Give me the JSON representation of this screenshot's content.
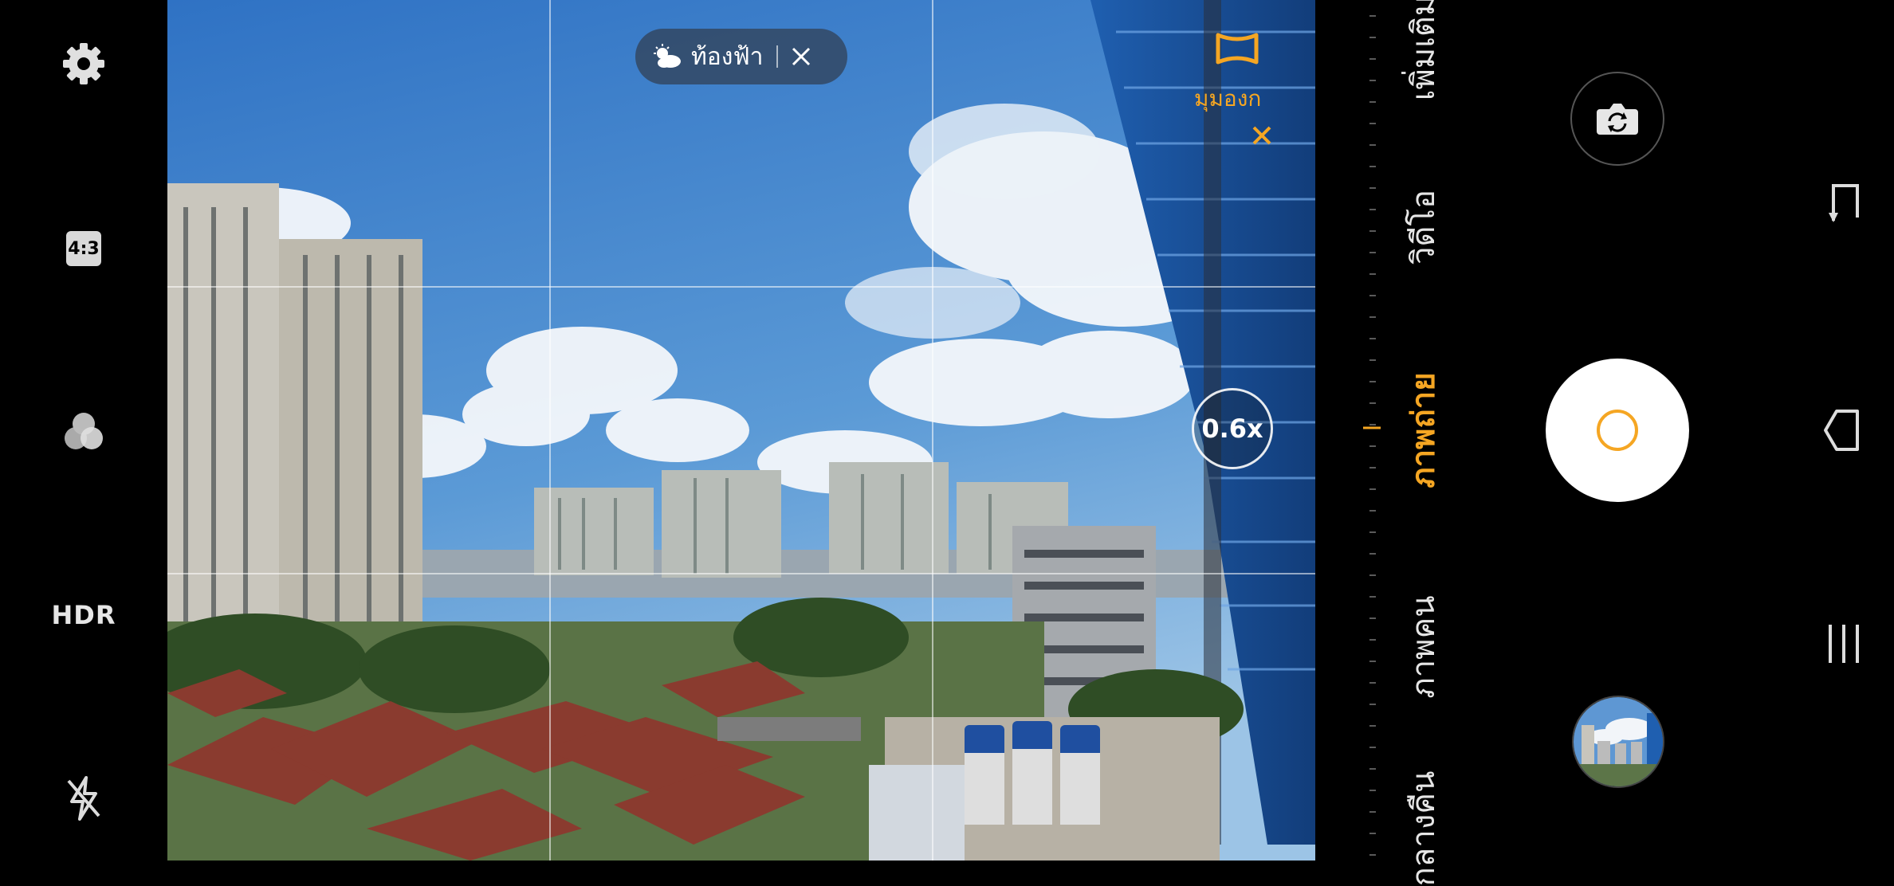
{
  "left_bar": {
    "settings_icon": "gear-icon",
    "aspect_ratio": "4:3",
    "filters_icon": "filters-icon",
    "hdr": "HDR",
    "flash_icon": "flash-off-icon"
  },
  "viewfinder": {
    "scene_optimizer": {
      "icon": "cloud-sun-icon",
      "label": "ท้องฟ้า"
    },
    "ultra_wide_label": "มุมองก",
    "zoom": "0.6x"
  },
  "modes": [
    {
      "label": "เพิ่มเติม",
      "active": false
    },
    {
      "label": "วิดีโอ",
      "active": false
    },
    {
      "label": "ภาพถ่าย",
      "active": true
    },
    {
      "label": "ภาพคน",
      "active": false
    },
    {
      "label": "กลางคืน",
      "active": false
    }
  ],
  "colors": {
    "accent": "#f5a623",
    "chip_bg": "#32465f",
    "shutter": "#ffffff"
  }
}
